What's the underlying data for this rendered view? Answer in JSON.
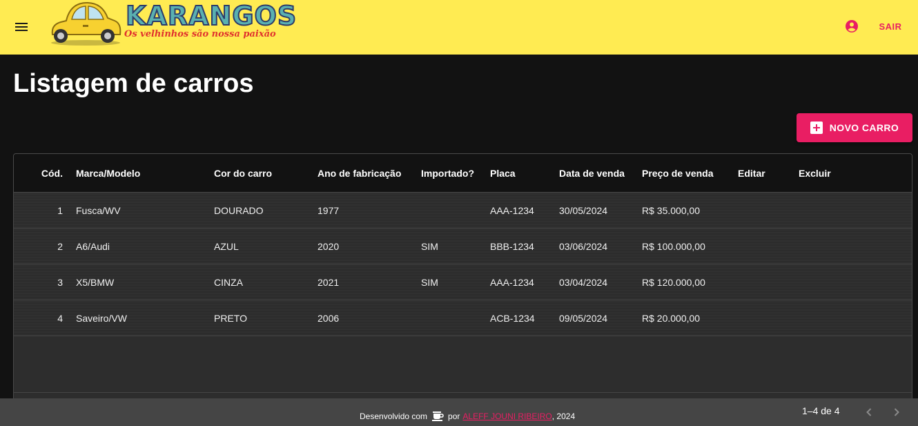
{
  "header": {
    "logo_title": "KARANGOS",
    "logo_subtitle": "Os velhinhos são nossa paixão",
    "logout_label": "SAIR",
    "background": "#ffeb52",
    "accent": "#e91e63"
  },
  "page": {
    "title": "Listagem de carros",
    "new_button_label": "NOVO CARRO"
  },
  "table": {
    "columns": [
      "Cód.",
      "Marca/Modelo",
      "Cor do carro",
      "Ano de fabricação",
      "Importado?",
      "Placa",
      "Data de venda",
      "Preço de venda",
      "Editar",
      "Excluir"
    ],
    "rows": [
      {
        "id": "1",
        "model": "Fusca/WV",
        "color": "DOURADO",
        "year": "1977",
        "imported": "",
        "plate": "AAA-1234",
        "sale_date": "30/05/2024",
        "price": "R$ 35.000,00"
      },
      {
        "id": "2",
        "model": "A6/Audi",
        "color": "AZUL",
        "year": "2020",
        "imported": "SIM",
        "plate": "BBB-1234",
        "sale_date": "03/06/2024",
        "price": "R$ 100.000,00"
      },
      {
        "id": "3",
        "model": "X5/BMW",
        "color": "CINZA",
        "year": "2021",
        "imported": "SIM",
        "plate": "AAA-1234",
        "sale_date": "03/04/2024",
        "price": "R$ 120.000,00"
      },
      {
        "id": "4",
        "model": "Saveiro/VW",
        "color": "PRETO",
        "year": "2006",
        "imported": "",
        "plate": "ACB-1234",
        "sale_date": "09/05/2024",
        "price": "R$ 20.000,00"
      }
    ],
    "pagination": "1–4 de 4"
  },
  "footer": {
    "prefix": "Desenvolvido com",
    "by": "por",
    "author": "ALEFF JOUNI RIBEIRO",
    "year_suffix": ", 2024"
  }
}
